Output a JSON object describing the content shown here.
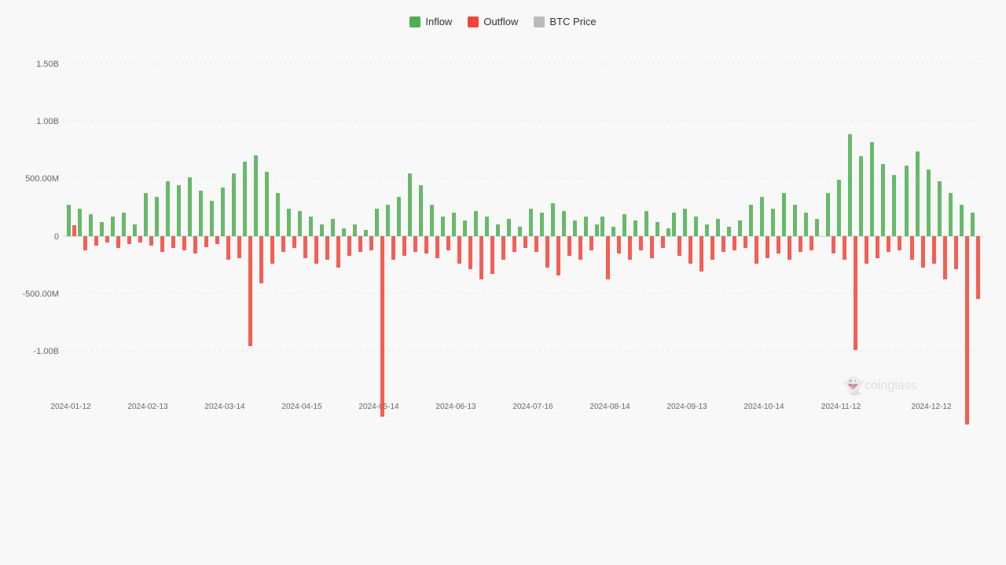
{
  "legend": {
    "items": [
      {
        "label": "Inflow",
        "color": "#4CAF50"
      },
      {
        "label": "Outflow",
        "color": "#f44336"
      },
      {
        "label": "BTC Price",
        "color": "#bbb"
      }
    ]
  },
  "chart": {
    "yAxis": {
      "labels": [
        "1.50B",
        "1.00B",
        "500.00M",
        "0",
        "-500.00M",
        "-1.00B"
      ]
    },
    "xAxis": {
      "labels": [
        "2024-01-12",
        "2024-02-13",
        "2024-03-14",
        "2024-04-15",
        "2024-05-14",
        "2024-06-13",
        "2024-07-16",
        "2024-08-14",
        "2024-09-13",
        "2024-10-14",
        "2024-11-12",
        "2024-12-12"
      ]
    }
  },
  "watermark": {
    "text": "coinglass"
  }
}
